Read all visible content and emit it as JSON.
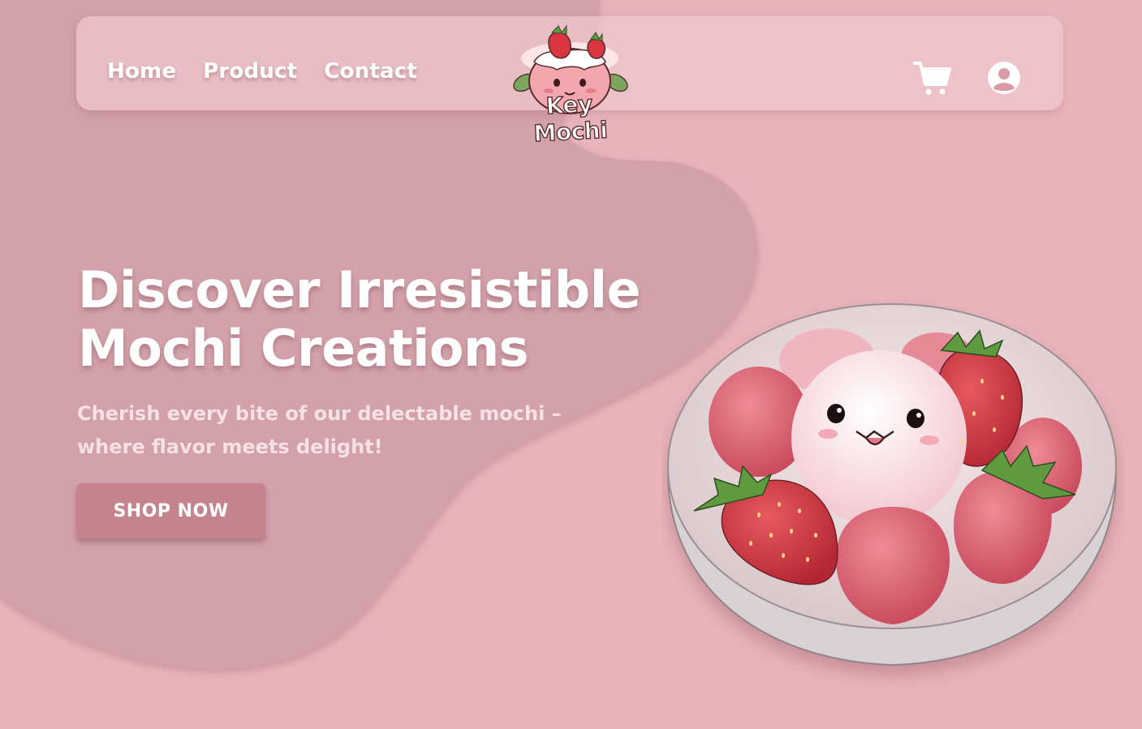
{
  "nav": {
    "links": [
      {
        "label": "Home"
      },
      {
        "label": "Product"
      },
      {
        "label": "Contact"
      }
    ],
    "logo_text": "Key Mochi",
    "cart_icon": "cart-icon",
    "profile_icon": "user-avatar-icon"
  },
  "hero": {
    "title_line1": "Discover Irresistible",
    "title_line2": "Mochi Creations",
    "subtitle": "Cherish every bite of our delectable mochi – where flavor meets delight!",
    "cta_label": "SHOP NOW"
  },
  "colors": {
    "background": "#e8b4bb",
    "blob": "#d2a1aa",
    "navbar": "#f0c8ce",
    "button": "#c5848d",
    "text": "#ffffff"
  }
}
